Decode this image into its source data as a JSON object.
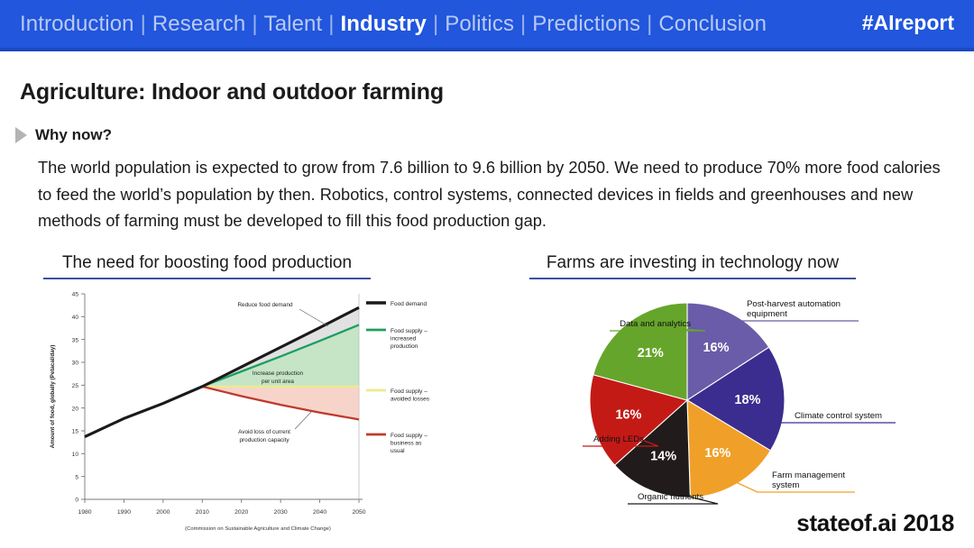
{
  "nav": {
    "separator": "|",
    "items": [
      {
        "label": "Introduction",
        "active": false
      },
      {
        "label": "Research",
        "active": false
      },
      {
        "label": "Talent",
        "active": false
      },
      {
        "label": "Industry",
        "active": true
      },
      {
        "label": "Politics",
        "active": false
      },
      {
        "label": "Predictions",
        "active": false
      },
      {
        "label": "Conclusion",
        "active": false
      }
    ],
    "hashtag": "#AIreport",
    "bar_color": "#2156dd",
    "active_color": "#ffffff",
    "inactive_color": "#b9c9f2"
  },
  "slide": {
    "title": "Agriculture: Indoor and outdoor farming",
    "section_label": "Why now?",
    "body": "The world population is expected to grow from 7.6 billion to 9.6 billion by 2050. We need to produce 70% more food calories to feed the world’s population by then. Robotics, control systems, connected devices in fields and greenhouses and new methods of farming must be developed to fill this food production gap.",
    "footer_brand": "stateof.ai 2018",
    "accent_rule_color": "#3d4fa1"
  },
  "panels": {
    "left_heading": "The need for boosting food production",
    "right_heading": "Farms are investing in technology now"
  },
  "chart_data": [
    {
      "type": "area",
      "title": "The need for boosting food production",
      "xlabel": "",
      "ylabel": "Amount of food, globally (Petacal/day)",
      "caption": "(Commission on Sustainable Agriculture and Climate Change)",
      "xlim": [
        1980,
        2050
      ],
      "ylim": [
        0,
        45
      ],
      "xticks": [
        "1980",
        "1990",
        "2000",
        "2010",
        "2020",
        "2030",
        "2040",
        "2050"
      ],
      "yticks": [
        "0",
        "5",
        "10",
        "15",
        "20",
        "25",
        "30",
        "35",
        "40",
        "45"
      ],
      "grid": false,
      "legend_position": "right",
      "x": [
        1980,
        1990,
        2000,
        2010,
        2020,
        2030,
        2040,
        2050
      ],
      "series": [
        {
          "name": "Food demand",
          "color": "#1a1a1a",
          "values": [
            13.7,
            17.7,
            21.0,
            24.7,
            29.0,
            33.3,
            37.6,
            42.0
          ]
        },
        {
          "name": "Food supply – increased production",
          "color": "#1f9d61",
          "values": [
            13.7,
            17.7,
            21.0,
            24.7,
            28.0,
            31.3,
            34.7,
            38.2
          ]
        },
        {
          "name": "Food supply – avoided losses",
          "color": "#ecec8a",
          "values": [
            13.7,
            17.7,
            21.0,
            24.7,
            24.7,
            24.7,
            24.7,
            24.7
          ]
        },
        {
          "name": "Food supply – business as usual",
          "color": "#c0392b",
          "values": [
            13.7,
            17.7,
            21.0,
            24.7,
            22.6,
            20.7,
            19.0,
            17.5
          ]
        }
      ],
      "annotations": [
        {
          "text": "Reduce food demand",
          "lines": [
            "Reduce food demand"
          ]
        },
        {
          "text": "Increase production per unit area",
          "lines": [
            "Increase production",
            "per unit area"
          ]
        },
        {
          "text": "Avoid loss of current production capacity",
          "lines": [
            "Avoid loss of current",
            "production capacity"
          ]
        }
      ],
      "legend": [
        {
          "label_lines": [
            "Food demand"
          ],
          "color": "#1a1a1a"
        },
        {
          "label_lines": [
            "Food supply –",
            "increased",
            "production"
          ],
          "color": "#1f9d61"
        },
        {
          "label_lines": [
            "Food supply –",
            "avoided losses"
          ],
          "color": "#ecec8a"
        },
        {
          "label_lines": [
            "Food supply –",
            "business as",
            "usual"
          ],
          "color": "#c0392b"
        }
      ]
    },
    {
      "type": "pie",
      "title": "Farms are investing in technology now",
      "legend_position": "callouts",
      "labels": [
        "Post-harvest automation equipment",
        "Climate control system",
        "Farm management system",
        "Organic nutrients",
        "Adding LEDs",
        "Data and analytics"
      ],
      "values": [
        16,
        18,
        16,
        14,
        16,
        21
      ],
      "value_labels": [
        "16%",
        "18%",
        "16%",
        "14%",
        "16%",
        "21%"
      ],
      "colors": [
        "#6a5ca8",
        "#3b2d8f",
        "#f0a028",
        "#211c1b",
        "#c41a16",
        "#66a52b"
      ],
      "slices": [
        {
          "label_lines": [
            "Post-harvest automation",
            "equipment"
          ],
          "value": 16,
          "value_label": "16%",
          "color": "#6a5ca8"
        },
        {
          "label_lines": [
            "Climate control system"
          ],
          "value": 18,
          "value_label": "18%",
          "color": "#3b2d8f"
        },
        {
          "label_lines": [
            "Farm management",
            "system"
          ],
          "value": 16,
          "value_label": "16%",
          "color": "#f0a028"
        },
        {
          "label_lines": [
            "Organic nutrients"
          ],
          "value": 14,
          "value_label": "14%",
          "color": "#211c1b"
        },
        {
          "label_lines": [
            "Adding LEDs"
          ],
          "value": 16,
          "value_label": "16%",
          "color": "#c41a16"
        },
        {
          "label_lines": [
            "Data and analytics"
          ],
          "value": 21,
          "value_label": "21%",
          "color": "#66a52b"
        }
      ]
    }
  ]
}
